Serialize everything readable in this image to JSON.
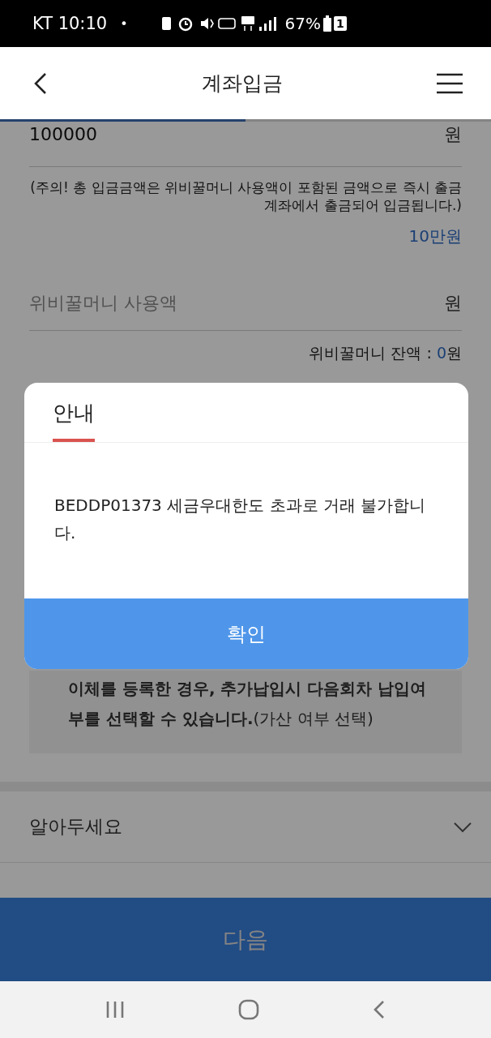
{
  "status_bar": {
    "time": "KT 10:10",
    "notification_dot": "•",
    "battery_percent": "67%",
    "sim_slot": "1"
  },
  "header": {
    "title": "계좌입금"
  },
  "progress": {
    "level": 0.5
  },
  "amount": {
    "value": "100000",
    "unit": "원"
  },
  "notice": "(주의! 총 입금금액은 위비꿀머니 사용액이 포함된 금액으로 즉시 출금계좌에서 출금되어 입금됩니다.)",
  "quick_amount": "10만원",
  "points_field": {
    "placeholder": "위비꿀머니 사용액",
    "unit": "원"
  },
  "points_balance": {
    "label": "위비꿀머니 잔액 : ",
    "value": "0",
    "unit": "원"
  },
  "info_box": {
    "text": "**이체를 등록한 경우, 추가납입시 다음회차 납입여부를 선택할 수 있습니다.**(가산 여부 선택)"
  },
  "accordion": {
    "title": "알아두세요",
    "expanded": false
  },
  "next_button": "다음",
  "dialog": {
    "title": "안내",
    "message": "BEDDP01373 세금우대한도 초과로 거래 불가합니다.",
    "confirm": "확인"
  }
}
